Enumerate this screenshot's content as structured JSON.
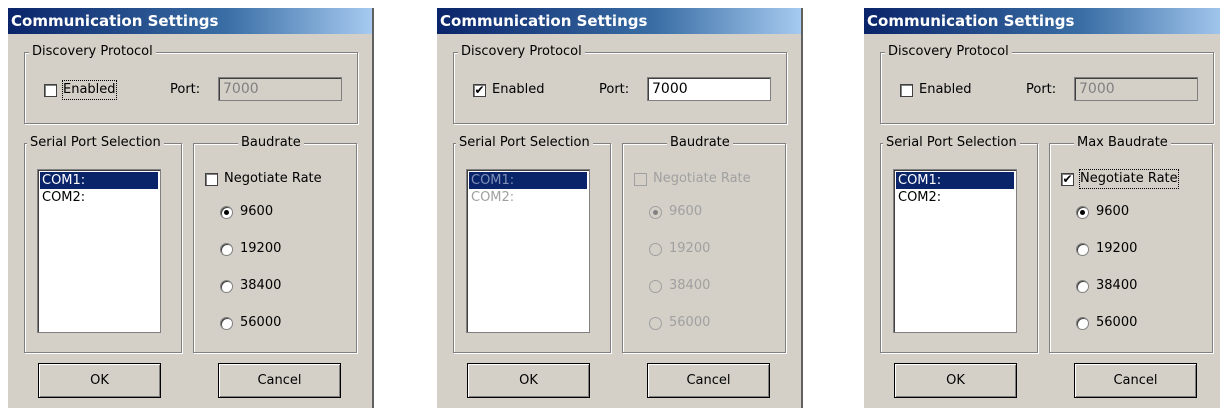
{
  "dialogs": [
    {
      "title": "Communication Settings",
      "discovery": {
        "legend": "Discovery Protocol",
        "enabled_label": "Enabled",
        "enabled": false,
        "port_label": "Port:",
        "port_value": "7000",
        "port_disabled": true
      },
      "serial": {
        "legend": "Serial Port Selection",
        "items": [
          "COM1:",
          "COM2:"
        ],
        "selected": "COM1:",
        "disabled": false
      },
      "baud": {
        "legend": "Baudrate",
        "negotiate_label": "Negotiate Rate",
        "negotiate": false,
        "disabled": false,
        "rates": [
          "9600",
          "19200",
          "38400",
          "56000"
        ],
        "selected_rate": "9600"
      },
      "buttons": {
        "ok": "OK",
        "cancel": "Cancel"
      }
    },
    {
      "title": "Communication Settings",
      "discovery": {
        "legend": "Discovery Protocol",
        "enabled_label": "Enabled",
        "enabled": true,
        "port_label": "Port:",
        "port_value": "7000",
        "port_disabled": false
      },
      "serial": {
        "legend": "Serial Port Selection",
        "items": [
          "COM1:",
          "COM2:"
        ],
        "selected": "COM1:",
        "disabled": true
      },
      "baud": {
        "legend": "Baudrate",
        "negotiate_label": "Negotiate Rate",
        "negotiate": false,
        "disabled": true,
        "rates": [
          "9600",
          "19200",
          "38400",
          "56000"
        ],
        "selected_rate": "9600"
      },
      "buttons": {
        "ok": "OK",
        "cancel": "Cancel"
      }
    },
    {
      "title": "Communication Settings",
      "discovery": {
        "legend": "Discovery Protocol",
        "enabled_label": "Enabled",
        "enabled": false,
        "port_label": "Port:",
        "port_value": "7000",
        "port_disabled": true
      },
      "serial": {
        "legend": "Serial Port Selection",
        "items": [
          "COM1:",
          "COM2:"
        ],
        "selected": "COM1:",
        "disabled": false
      },
      "baud": {
        "legend": "Max Baudrate",
        "negotiate_label": "Negotiate Rate",
        "negotiate": true,
        "disabled": false,
        "rates": [
          "9600",
          "19200",
          "38400",
          "56000"
        ],
        "selected_rate": "9600"
      },
      "buttons": {
        "ok": "OK",
        "cancel": "Cancel"
      }
    }
  ]
}
